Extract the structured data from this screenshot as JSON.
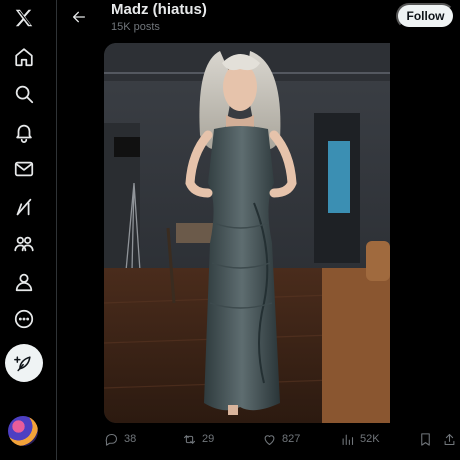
{
  "rail": {
    "items": [
      {
        "icon": "x-logo-icon"
      },
      {
        "icon": "home-icon"
      },
      {
        "icon": "search-icon"
      },
      {
        "icon": "bell-icon"
      },
      {
        "icon": "mail-icon"
      },
      {
        "icon": "grok-icon"
      },
      {
        "icon": "communities-icon"
      },
      {
        "icon": "profile-icon"
      },
      {
        "icon": "more-icon"
      }
    ],
    "compose_icon": "feather-plus-icon"
  },
  "header": {
    "title": "Madz (hiatus)",
    "posts_count": "15K posts",
    "follow_label": "Follow"
  },
  "actions": {
    "replies": "38",
    "reposts": "29",
    "likes": "827",
    "views": "52K"
  },
  "colors": {
    "background": "#000000",
    "text": "#e7e9ea",
    "muted": "#71767b",
    "button_bg": "#eff3f4",
    "divider": "#2f3336"
  }
}
